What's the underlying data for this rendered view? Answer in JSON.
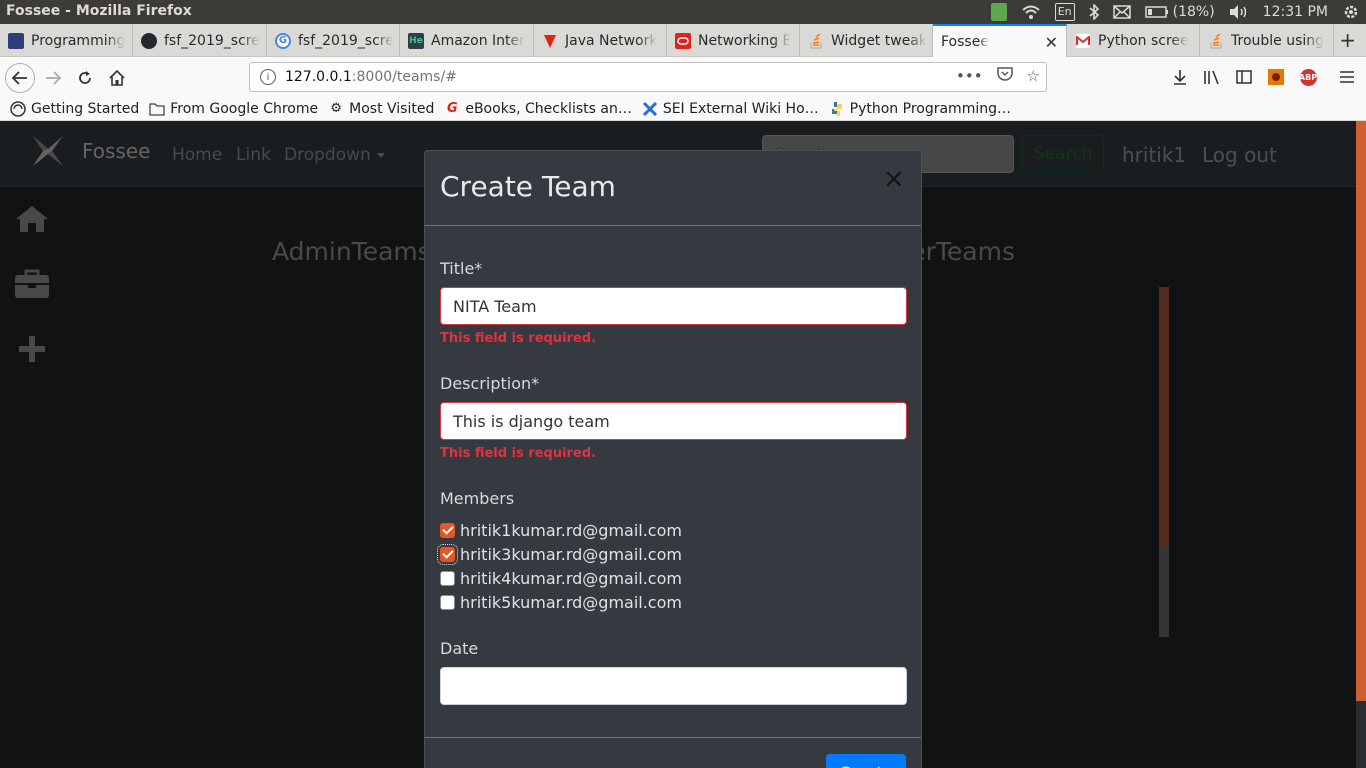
{
  "os": {
    "window_title": "Fossee - Mozilla Firefox",
    "battery": "(18%)",
    "time": "12:31 PM",
    "keyboard_layout": "En"
  },
  "browser": {
    "tabs": [
      {
        "label": "Programming",
        "icon": "book-icon",
        "color": "#2c3e7a"
      },
      {
        "label": "fsf_2019_scre",
        "icon": "github-icon",
        "color": "#24292e"
      },
      {
        "label": "fsf_2019_scre",
        "icon": "google-icon",
        "color": "#4285f4"
      },
      {
        "label": "Amazon Inter",
        "icon": "hackerearth-icon",
        "color": "#2c3e50"
      },
      {
        "label": "Java Network",
        "icon": "geeksforgeeks-icon",
        "color": "#e2231a"
      },
      {
        "label": "Networking E",
        "icon": "oracle-icon",
        "color": "#e2231a"
      },
      {
        "label": "Widget tweak",
        "icon": "stackoverflow-icon",
        "color": "#f48024"
      },
      {
        "label": "Fossee",
        "icon": "",
        "color": "",
        "active": true
      },
      {
        "label": "Python scree",
        "icon": "gmail-icon",
        "color": "#d93025"
      },
      {
        "label": "Trouble using",
        "icon": "stackoverflow-icon",
        "color": "#f48024"
      }
    ],
    "url_host": "127.0.0.1",
    "url_rest": ":8000/teams/#",
    "bookmarks": [
      {
        "label": "Getting Started",
        "icon": "firefox-icon"
      },
      {
        "label": "From Google Chrome",
        "icon": "folder-icon"
      },
      {
        "label": "Most Visited",
        "icon": "gear-icon"
      },
      {
        "label": "eBooks, Checklists an…",
        "icon": "g-icon"
      },
      {
        "label": "SEI External Wiki Ho…",
        "icon": "confluence-icon"
      },
      {
        "label": "Python Programming…",
        "icon": "python-icon"
      }
    ]
  },
  "site": {
    "brand": "Fossee",
    "nav_links": [
      "Home",
      "Link",
      "Dropdown"
    ],
    "search_placeholder": "Search",
    "search_button": "Search",
    "username": "hritik1",
    "logout": "Log out",
    "heading_left": "AdminTeams",
    "heading_right": "erTeams",
    "accent_color": "#e95420"
  },
  "modal": {
    "title": "Create Team",
    "close_label": "×",
    "title_label": "Title*",
    "title_value": "NITA Team",
    "title_error": "This field is required.",
    "description_label": "Description*",
    "description_value": "This is django team",
    "description_error": "This field is required.",
    "members_label": "Members",
    "members": [
      {
        "email": "hritik1kumar.rd@gmail.com",
        "checked": true
      },
      {
        "email": "hritik3kumar.rd@gmail.com",
        "checked": true
      },
      {
        "email": "hritik4kumar.rd@gmail.com",
        "checked": false
      },
      {
        "email": "hritik5kumar.rd@gmail.com",
        "checked": false
      }
    ],
    "date_label": "Date",
    "date_value": "",
    "submit_label": "Create"
  }
}
